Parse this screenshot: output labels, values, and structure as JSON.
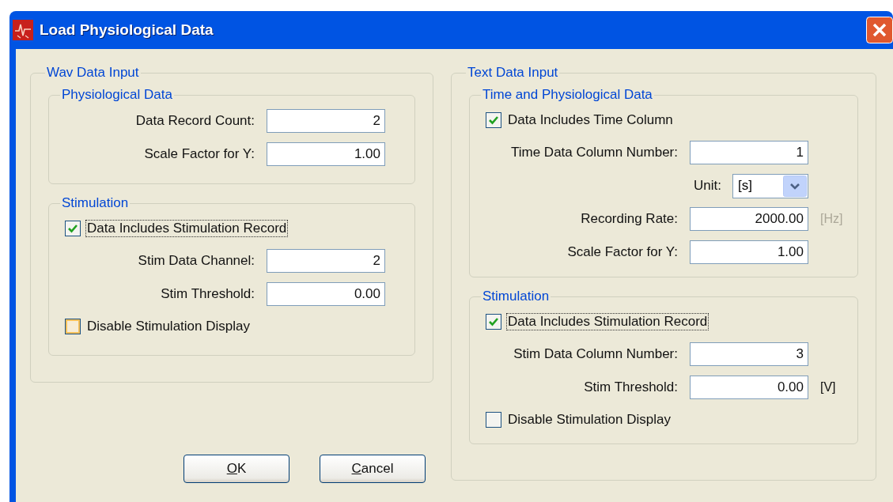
{
  "window": {
    "title": "Load Physiological Data"
  },
  "wav_data_input": {
    "title": "Wav Data Input",
    "groups": [
      {
        "title": "Physiological Data",
        "rows": [
          {
            "kind": "field",
            "label": "Data Record Count:",
            "value": "2"
          },
          {
            "kind": "field",
            "label": "Scale Factor for Y:",
            "value": "1.00"
          }
        ]
      },
      {
        "title": "Stimulation",
        "rows": [
          {
            "kind": "checkbox",
            "label": "Data Includes Stimulation Record",
            "checked": true,
            "focused": true,
            "hovered": false
          },
          {
            "kind": "field",
            "label": "Stim Data Channel:",
            "value": "2"
          },
          {
            "kind": "field",
            "label": "Stim Threshold:",
            "value": "0.00"
          },
          {
            "kind": "checkbox",
            "label": "Disable Stimulation Display",
            "checked": false,
            "focused": false,
            "hovered": true
          }
        ]
      }
    ]
  },
  "text_data_input": {
    "title": "Text Data Input",
    "groups": [
      {
        "title": "Time and Physiological Data",
        "rows": [
          {
            "kind": "checkbox",
            "label": "Data Includes Time Column",
            "checked": true,
            "focused": false,
            "hovered": false
          },
          {
            "kind": "field",
            "label": "Time Data Column Number:",
            "value": "1"
          },
          {
            "kind": "select",
            "label": "Unit:",
            "value": "[s]"
          },
          {
            "kind": "field",
            "label": "Recording Rate:",
            "value": "2000.00",
            "unit": "[Hz]",
            "unit_disabled": true
          },
          {
            "kind": "field",
            "label": "Scale Factor for Y:",
            "value": "1.00"
          }
        ]
      },
      {
        "title": "Stimulation",
        "rows": [
          {
            "kind": "checkbox",
            "label": "Data Includes Stimulation Record",
            "checked": true,
            "focused": true,
            "hovered": false
          },
          {
            "kind": "field",
            "label": "Stim Data Column Number:",
            "value": "3"
          },
          {
            "kind": "field",
            "label": "Stim Threshold:",
            "value": "0.00",
            "unit": "[V]",
            "unit_disabled": false
          },
          {
            "kind": "checkbox",
            "label": "Disable Stimulation Display",
            "checked": false,
            "focused": false,
            "hovered": false
          }
        ]
      }
    ]
  },
  "buttons": [
    {
      "label": "OK",
      "mnemonic_underlined": true
    },
    {
      "label": "Cancel",
      "mnemonic_underlined": true
    }
  ]
}
